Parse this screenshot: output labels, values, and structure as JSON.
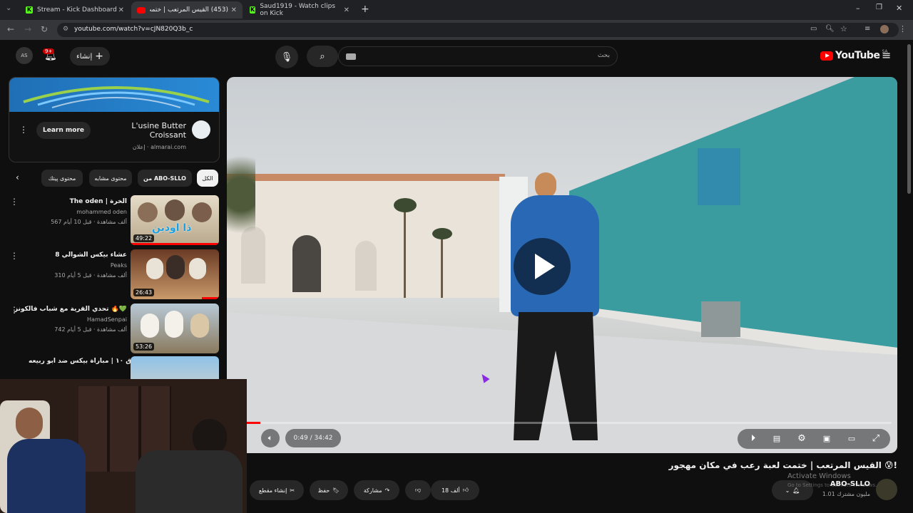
{
  "browser": {
    "tabs": [
      {
        "title": "Stream - Kick Dashboard"
      },
      {
        "title": "(453) القيس المرتعب | ختمت لعـ"
      },
      {
        "title": "Saud1919 - Watch clips on Kick"
      }
    ],
    "url": "youtube.com/watch?v=cJN820Q3b_c"
  },
  "header": {
    "notif_count": "9+",
    "create_label": "إنشاء",
    "search_placeholder": "بحث",
    "logo_text": "YouTube",
    "region": "SA"
  },
  "ad": {
    "title_line1": "L'usine Butter",
    "title_line2": "Croissant",
    "sponsor": "إعلان · almarai.com",
    "cta": "Learn more"
  },
  "chips": [
    "الكل",
    "من ABO-SLLO",
    "محتوى مشابه",
    "محتوى پيتك"
  ],
  "related": [
    {
      "title": "The oden | الخرة",
      "channel": "mohammed oden",
      "meta": "567 ألف مشاهدة · قبل 10 أيام",
      "duration": "49:22",
      "thumb_text": "ذا اودين"
    },
    {
      "title": "عشاء بيكس الشوالي 8",
      "channel": "Peaks",
      "meta": "310 ألف مشاهدة · قبل 5 أيام",
      "duration": "26:43",
      "thumb_text": ""
    },
    {
      "title": "تحدي القرية مع شباب فالكونز 🔥💚",
      "channel": "HamadSenpai",
      "meta": "742 ألف مشاهدة · قبل 5 أيام",
      "duration": "53:26",
      "thumb_text": ""
    },
    {
      "title": "طرق ١٠ | مباراة بيكس ضد ابو ربيعه ⚽",
      "channel": "",
      "meta": "",
      "duration": "",
      "thumb_text": ""
    }
  ],
  "player": {
    "time": "0:49 / 34:42",
    "progress": 0.0235
  },
  "video": {
    "title": "القيس المرتعب | ختمت لعبة رعب في مكان مهجور 😰!",
    "channel": "ABO-SLLO",
    "subscribers": "1.01 مليون مشترك",
    "likes": "18 ألف",
    "share": "مشاركة",
    "save": "حفظ",
    "clip": "إنشاء مقطع"
  },
  "watermark": {
    "line1": "Activate Windows",
    "line2": "Go to Settings to activate Windows."
  },
  "colors": {
    "accent": "#ff0000",
    "kick": "#53fc18"
  }
}
